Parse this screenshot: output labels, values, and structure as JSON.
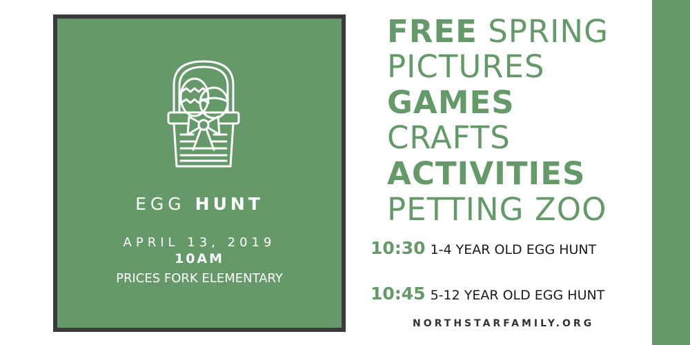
{
  "colors": {
    "brand_green": "#66996a",
    "frame_border": "#3a3a3a",
    "text_dark": "#1a1a1a",
    "background": "#ffffff"
  },
  "left_panel": {
    "icon": "easter-basket-icon",
    "title_part1": "EGG",
    "title_part2": "HUNT",
    "date": "APRIL 13, 2019",
    "time": "10AM",
    "location": "PRICES FORK ELEMENTARY"
  },
  "features": [
    {
      "bold": "FREE",
      "regular": "SPRING"
    },
    {
      "bold": "",
      "regular": "PICTURES"
    },
    {
      "bold": "GAMES",
      "regular": ""
    },
    {
      "bold": "",
      "regular": "CRAFTS"
    },
    {
      "bold": "ACTIVITIES",
      "regular": ""
    },
    {
      "bold": "",
      "regular": "PETTING ZOO"
    }
  ],
  "schedule": [
    {
      "time": "10:30",
      "description": "1-4 YEAR OLD EGG HUNT"
    },
    {
      "time": "10:45",
      "description": "5-12 YEAR OLD EGG HUNT"
    }
  ],
  "website": "NORTHSTARFAMILY.ORG"
}
